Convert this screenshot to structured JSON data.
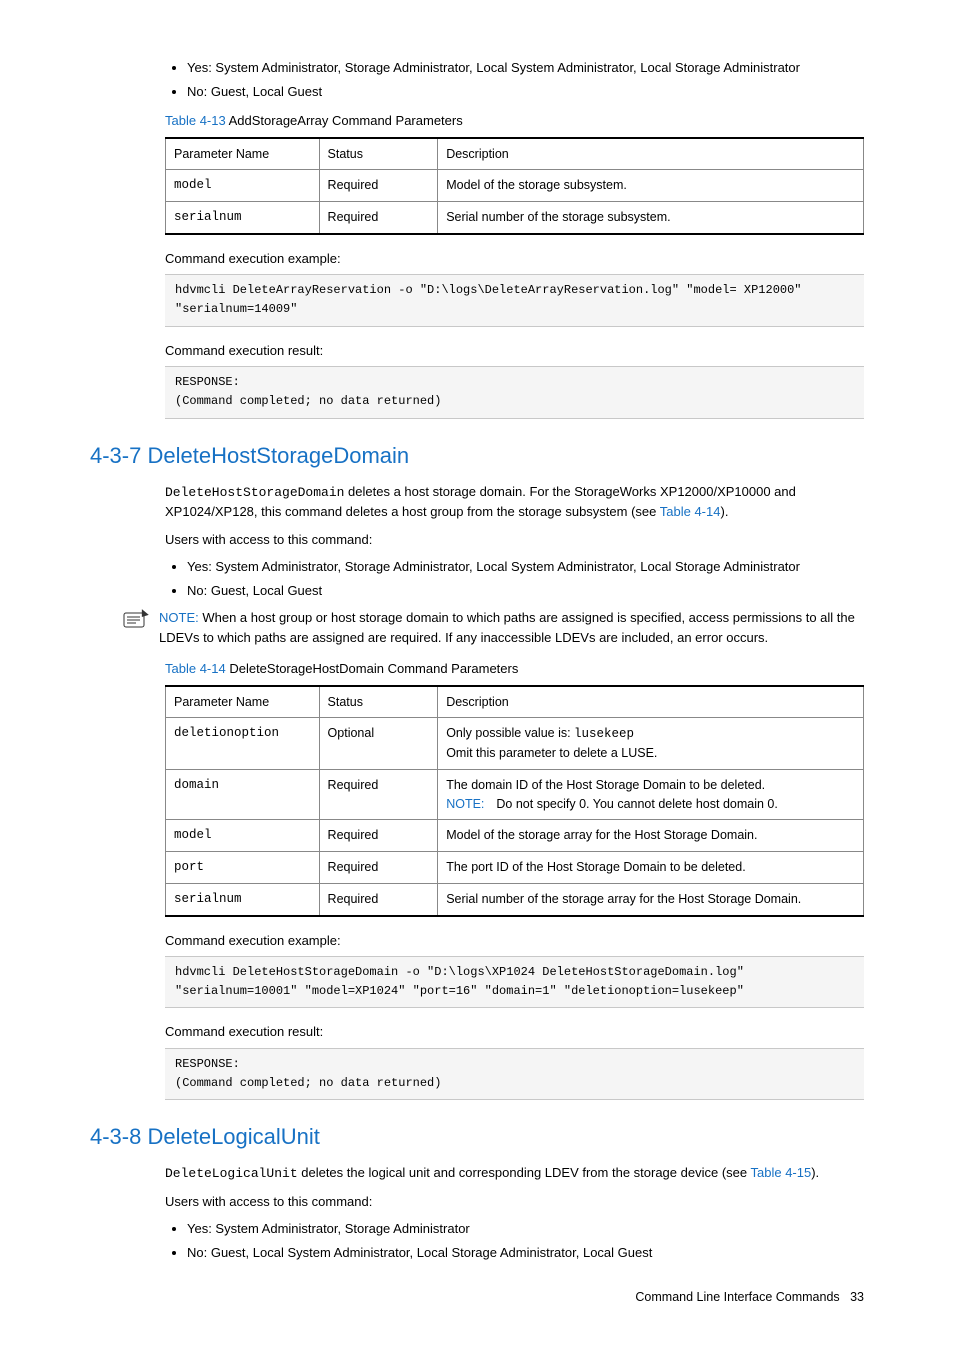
{
  "top": {
    "bullets": [
      "Yes: System Administrator, Storage Administrator, Local System Administrator, Local Storage Administrator",
      "No: Guest, Local Guest"
    ],
    "table_caption_link": "Table 4-13",
    "table_caption_rest": "  AddStorageArray Command Parameters",
    "table": {
      "headers": [
        "Parameter Name",
        "Status",
        "Description"
      ],
      "rows": [
        {
          "name": "model",
          "status": "Required",
          "desc": "Model of the storage subsystem."
        },
        {
          "name": "serialnum",
          "status": "Required",
          "desc": "Serial number of the storage subsystem."
        }
      ]
    },
    "exec_label": "Command execution example:",
    "exec_code": "hdvmcli DeleteArrayReservation -o \"D:\\logs\\DeleteArrayReservation.log\" \"model= XP12000\" \"serialnum=14009\"",
    "result_label": "Command execution result:",
    "result_code": "RESPONSE:\n(Command completed; no data returned)"
  },
  "sec437": {
    "heading": "4-3-7 DeleteHostStorageDomain",
    "intro_code": "DeleteHostStorageDomain",
    "intro_rest": " deletes a host storage domain. For the StorageWorks XP12000/XP10000 and XP1024/XP128, this command deletes a host group from the storage subsystem (see ",
    "intro_link": "Table 4-14",
    "intro_close": ").",
    "access_label": "Users with access to this command:",
    "bullets": [
      "Yes: System Administrator, Storage Administrator, Local System Administrator, Local Storage Administrator",
      "No: Guest, Local Guest"
    ],
    "note_label": "NOTE:",
    "note_body": "  When a host group or host storage domain to which paths are assigned is specified, access permissions to all the LDEVs to which paths are assigned are required. If any inaccessible LDEVs are included, an error occurs.",
    "table_caption_link": "Table 4-14",
    "table_caption_rest": "  DeleteStorageHostDomain Command Parameters",
    "table": {
      "headers": [
        "Parameter Name",
        "Status",
        "Description"
      ],
      "rows": [
        {
          "name": "deletionoption",
          "status": "Optional",
          "desc_pre": "Only possible value is: ",
          "desc_code": "lusekeep",
          "desc_line2": "Omit this parameter to delete a LUSE."
        },
        {
          "name": "domain",
          "status": "Required",
          "desc_line1": "The domain ID of the Host Storage Domain to be deleted.",
          "note_label": "NOTE:",
          "note_text": "Do not specify 0. You cannot delete host domain 0."
        },
        {
          "name": "model",
          "status": "Required",
          "desc": "Model of the storage array for the Host Storage Domain."
        },
        {
          "name": "port",
          "status": "Required",
          "desc": "The port ID of the Host Storage Domain to be deleted."
        },
        {
          "name": "serialnum",
          "status": "Required",
          "desc": "Serial number of the storage array for the Host Storage Domain."
        }
      ]
    },
    "exec_label": "Command execution example:",
    "exec_code": "hdvmcli DeleteHostStorageDomain -o \"D:\\logs\\XP1024 DeleteHostStorageDomain.log\" \"serialnum=10001\" \"model=XP1024\" \"port=16\" \"domain=1\" \"deletionoption=lusekeep\"",
    "result_label": "Command execution result:",
    "result_code": "RESPONSE:\n(Command completed; no data returned)"
  },
  "sec438": {
    "heading": "4-3-8 DeleteLogicalUnit",
    "intro_code": "DeleteLogicalUnit",
    "intro_rest": " deletes the logical unit and corresponding LDEV from the storage device (see ",
    "intro_link": "Table 4-15",
    "intro_close": ").",
    "access_label": "Users with access to this command:",
    "bullets": [
      "Yes: System Administrator, Storage Administrator",
      "No: Guest, Local System Administrator, Local Storage Administrator, Local Guest"
    ]
  },
  "footer": {
    "label": "Command Line Interface Commands",
    "page": "33"
  }
}
